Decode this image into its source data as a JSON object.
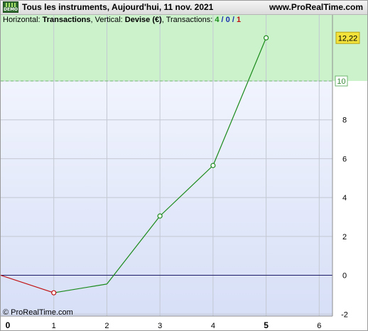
{
  "window": {
    "title": "Tous les instruments, Aujourd'hui, 11 nov. 2021",
    "website": "www.ProRealTime.com",
    "badge_text": "DEMO"
  },
  "info_line": {
    "horizontal_label": "Horizontal: ",
    "horizontal_value": "Transactions",
    "vertical_label": ", Vertical: ",
    "vertical_value": "Devise (€)",
    "transactions_label": ", Transactions: ",
    "winners": "4",
    "sep1": " / ",
    "neutral": "0",
    "sep2": " / ",
    "losers": "1"
  },
  "copyright": "© ProRealTime.com",
  "colors": {
    "gain": "#1a8a1a",
    "loss": "#c01010",
    "zero_line": "#1a1a66",
    "target_zone": "#ccf2cc",
    "value_badge": "#f2e23a"
  },
  "chart_data": {
    "type": "line",
    "x": [
      0,
      1,
      2,
      3,
      4,
      5
    ],
    "y": [
      0,
      -0.9,
      -0.45,
      3.05,
      5.65,
      12.22
    ],
    "markers_at": [
      1,
      3,
      4,
      5
    ],
    "xlim": [
      0,
      6.25
    ],
    "ylim": [
      -2.1,
      13.4
    ],
    "x_ticks": [
      "0",
      "1",
      "2",
      "3",
      "4",
      "5",
      "6"
    ],
    "x_bold_ticks": [
      "0",
      "5"
    ],
    "y_ticks": [
      "-2",
      "0",
      "2",
      "4",
      "6",
      "8",
      "10"
    ],
    "target_value": 10,
    "target_label": "10",
    "last_value_label": "12,22",
    "grid": true
  }
}
